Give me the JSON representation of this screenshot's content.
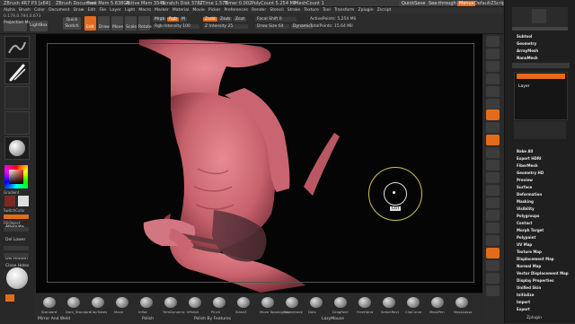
{
  "titlebar": {
    "app": "ZBrush 4R7 P3 [x64]",
    "doc": "ZBrush Document",
    "mem": "Free Mem 5.638GB",
    "active_mem": "Active Mem 3546",
    "scratch": "Scratch Disk 3787",
    "ztime": "ZTime 1.578",
    "timer": "Timer 0.002",
    "poly": "PolyCount 5.254 MP",
    "mesh": "MeshCount 1",
    "quicksave": "QuickSave",
    "see_through": "See-through 0",
    "menus_label": "Menus",
    "default_script": "DefaultZScript"
  },
  "menubar": {
    "items": [
      "Alpha",
      "Brush",
      "Color",
      "Document",
      "Draw",
      "Edit",
      "File",
      "Layer",
      "Light",
      "Macro",
      "Marker",
      "Material",
      "Movie",
      "Picker",
      "Preferences",
      "Render",
      "Stencil",
      "Stroke",
      "Texture",
      "Tool",
      "Transform",
      "Zplugin",
      "Zscript"
    ]
  },
  "coords": "0.179,0.794,0.673",
  "toolstrip": {
    "projection_master": "Projection Master",
    "lightbox": "LightBox",
    "quick_sketch": "Quick Sketch",
    "edit": "Edit",
    "draw": "Draw",
    "move": "Move",
    "scale": "Scale",
    "rotate": "Rotate",
    "mrgb": "Mrgb",
    "rgb": "Rgb",
    "m": "M",
    "rgb_intensity": "Rgb Intensity 100",
    "zadd": "Zadd",
    "zsub": "Zsub",
    "zcut": "Zcut",
    "z_intensity": "Z Intensity 25",
    "focal_shift": "Focal Shift 0",
    "draw_size": "Draw Size 64",
    "dynamic": "Dynamic",
    "active_points": "ActivePoints: 5,254 Mil",
    "total_points": "TotalPoints: 15.64 Mil"
  },
  "leftshelf": {
    "labels": [
      "Gradient",
      "SwitchColor",
      "Alternate",
      "FillObject",
      "Del Lower",
      "Del Hidden",
      "Close Holes"
    ]
  },
  "cursor_tooltip": "Ctrl",
  "palette": {
    "top_items": [
      "Subtool",
      "Geometry",
      "ArrayMesh",
      "NanoMesh",
      "Layers"
    ],
    "layer_name": "Layer",
    "mid_items": [
      "Bake All",
      "Export HDRI"
    ],
    "items": [
      "FiberMesh",
      "Geometry HD",
      "Preview",
      "Surface",
      "Deformation",
      "Masking",
      "Visibility",
      "Polygroups",
      "Contact",
      "Morph Target",
      "Polypaint",
      "UV Map",
      "Texture Map",
      "Displacement Map",
      "Normal Map",
      "Vector Displacement Map",
      "Display Properties",
      "Unified Skin",
      "Initialize",
      "Import",
      "Export"
    ],
    "footer": "Zplugin"
  },
  "bottomshelf": {
    "brushes": [
      "Standard",
      "Dam_Standard",
      "ClayTubes",
      "Move",
      "Inflat",
      "TrimDynamic",
      "hPolish",
      "Pinch",
      "Slash3",
      "Move Topological",
      "Snakehook",
      "Dots",
      "DragRect",
      "FreeHand",
      "SelectRect",
      "ClipCurve",
      "MaskPen",
      "MaskLasso"
    ],
    "mirror_weld": "Mirror And Weld",
    "polish": "Polish",
    "polish_features": "Polish By Features",
    "lazy_mouse": "LazyMouse"
  },
  "colors": {
    "accent": "#e36b1b",
    "skin": "#c7626c",
    "canvas_bg": "#050505"
  }
}
